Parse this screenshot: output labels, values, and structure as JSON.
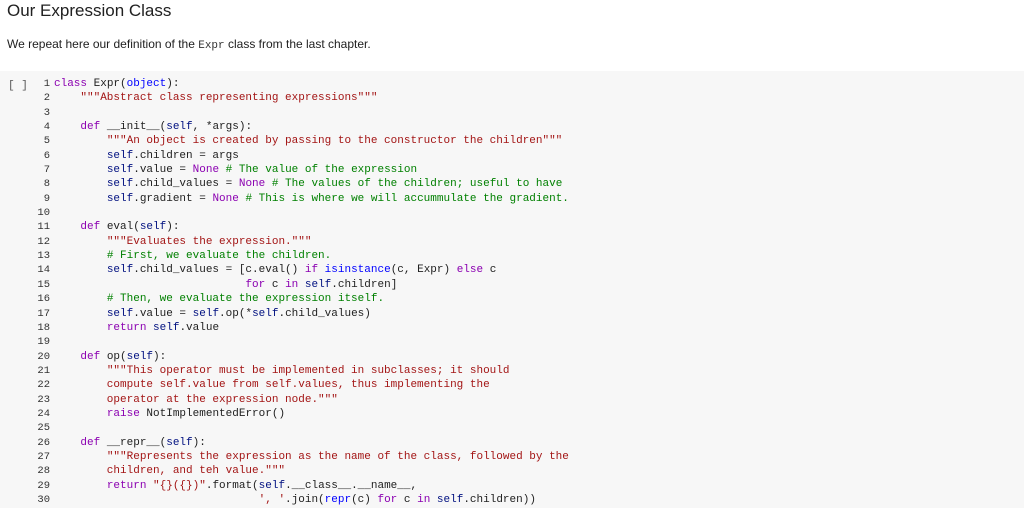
{
  "page": {
    "title": "Our Expression Class",
    "intro_before": "We repeat here our definition of the ",
    "intro_code": "Expr",
    "intro_after": " class from the last chapter."
  },
  "cell": {
    "run_label": "[ ]",
    "lines": [
      "class Expr(object):",
      "    \"\"\"Abstract class representing expressions\"\"\"",
      "",
      "    def __init__(self, *args):",
      "        \"\"\"An object is created by passing to the constructor the children\"\"\"",
      "        self.children = args",
      "        self.value = None # The value of the expression",
      "        self.child_values = None # The values of the children; useful to have",
      "        self.gradient = None # This is where we will accummulate the gradient.",
      "",
      "    def eval(self):",
      "        \"\"\"Evaluates the expression.\"\"\"",
      "        # First, we evaluate the children.",
      "        self.child_values = [c.eval() if isinstance(c, Expr) else c",
      "                             for c in self.children]",
      "        # Then, we evaluate the expression itself.",
      "        self.value = self.op(*self.child_values)",
      "        return self.value",
      "",
      "    def op(self):",
      "        \"\"\"This operator must be implemented in subclasses; it should",
      "        compute self.value from self.values, thus implementing the",
      "        operator at the expression node.\"\"\"",
      "        raise NotImplementedError()",
      "",
      "    def __repr__(self):",
      "        \"\"\"Represents the expression as the name of the class, followed by the",
      "        children, and teh value.\"\"\"",
      "        return \"{}({})\".format(self.__class__.__name__,",
      "                               ', '.join(repr(c) for c in self.children))"
    ]
  },
  "colors": {
    "keyword": "#8b00b1",
    "string": "#a31515",
    "comment": "#008000",
    "cell_background": "#f7f7f7"
  }
}
